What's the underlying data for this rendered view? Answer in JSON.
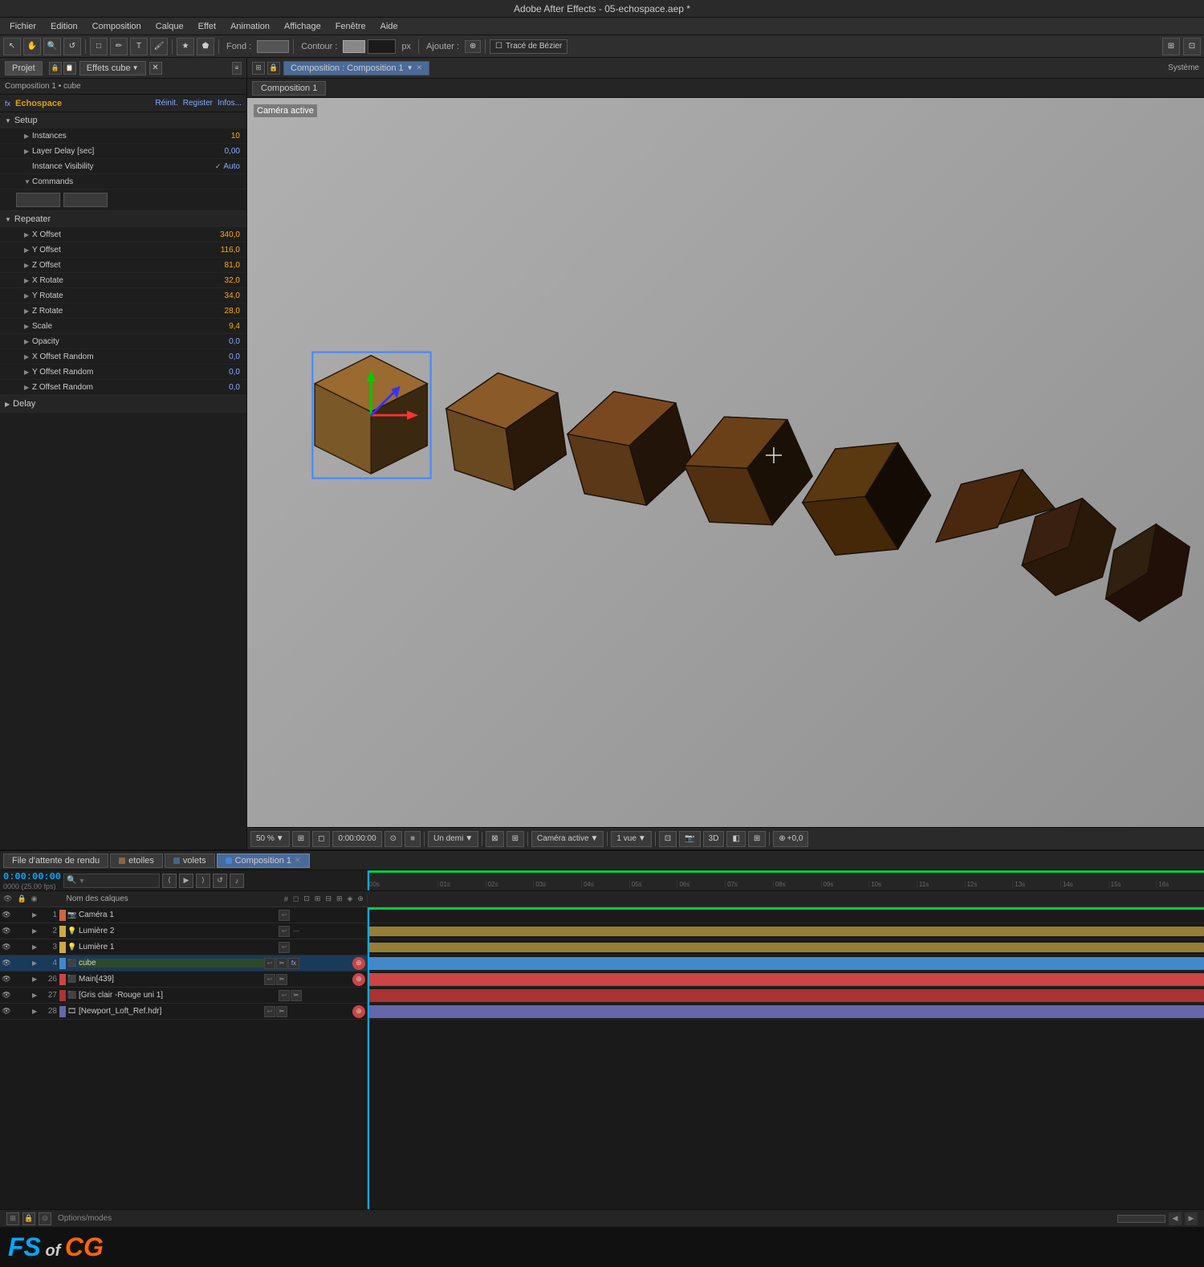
{
  "app": {
    "title": "Adobe After Effects - 05-echospace.aep *",
    "edition_label": "Edition"
  },
  "menubar": {
    "items": [
      "Fichier",
      "Edition",
      "Composition",
      "Calque",
      "Effet",
      "Animation",
      "Affichage",
      "Fenêtre",
      "Aide"
    ]
  },
  "toolbar": {
    "fond_label": "Fond :",
    "contour_label": "Contour :",
    "px_label": "px",
    "ajouter_label": "Ajouter :",
    "trace_label": "Tracé de Bézier"
  },
  "project_panel": {
    "title": "Effets cube",
    "breadcrumb": "Composition 1 • cube",
    "effects_name": "Echospace",
    "reinit": "Réinit.",
    "register": "Register",
    "infos": "Infos..."
  },
  "effects": {
    "setup": {
      "name": "Setup",
      "instances_label": "Instances",
      "instances_value": "10",
      "layer_delay_label": "Layer Delay [sec]",
      "layer_delay_value": "0,00",
      "instance_visibility_label": "Instance Visibility",
      "instance_visibility_value": "Auto",
      "commands_label": "Commands"
    },
    "repeater": {
      "name": "Repeater",
      "x_offset_label": "X Offset",
      "x_offset_value": "340,0",
      "y_offset_label": "Y Offset",
      "y_offset_value": "116,0",
      "z_offset_label": "Z Offset",
      "z_offset_value": "81,0",
      "x_rotate_label": "X Rotate",
      "x_rotate_value": "32,0",
      "y_rotate_label": "Y Rotate",
      "y_rotate_value": "34,0",
      "z_rotate_label": "Z Rotate",
      "z_rotate_value": "28,0",
      "scale_label": "Scale",
      "scale_value": "9,4",
      "opacity_label": "Opacity",
      "opacity_value": "0,0",
      "x_offset_random_label": "X Offset Random",
      "x_offset_random_value": "0,0",
      "y_offset_random_label": "Y Offset Random",
      "y_offset_random_value": "0,0",
      "z_offset_random_label": "Z Offset Random",
      "z_offset_random_value": "0,0"
    },
    "delay": {
      "name": "Delay"
    }
  },
  "viewer": {
    "composition_label": "Composition : Composition 1",
    "tab_label": "Composition 1",
    "camera_label": "Caméra active",
    "zoom": "50 %",
    "quality": "Un demi",
    "camera_dropdown": "Caméra active",
    "view_label": "1 vue",
    "offset_value": "+0,0"
  },
  "timeline": {
    "tabs": [
      {
        "label": "File d'attente de rendu"
      },
      {
        "label": "etoiles"
      },
      {
        "label": "volets"
      },
      {
        "label": "Composition 1",
        "active": true
      }
    ],
    "timecode": "0:00:00:00",
    "fps": "0000 (25.00 fps)",
    "search_placeholder": "🔍",
    "columns": {
      "layer_name": "Nom des calques"
    },
    "layers": [
      {
        "num": 1,
        "name": "Caméra 1",
        "color": "#cc6644",
        "type": "camera"
      },
      {
        "num": 2,
        "name": "Lumière 2",
        "color": "#ccaa44",
        "type": "light"
      },
      {
        "num": 3,
        "name": "Lumière 1",
        "color": "#ccaa44",
        "type": "light"
      },
      {
        "num": 4,
        "name": "cube",
        "color": "#4488cc",
        "type": "solid",
        "selected": true
      },
      {
        "num": 26,
        "name": "Main[439]",
        "color": "#cc4444",
        "type": "solid"
      },
      {
        "num": 27,
        "name": "[Gris clair -Rouge uni 1]",
        "color": "#aa3333",
        "type": "solid"
      },
      {
        "num": 28,
        "name": "[Newport_Loft_Ref.hdr]",
        "color": "#6666aa",
        "type": "footage"
      }
    ],
    "ruler_marks": [
      "00s",
      "01s",
      "02s",
      "03s",
      "04s",
      "05s",
      "06s",
      "07s",
      "08s",
      "09s",
      "10s",
      "11s",
      "12s",
      "13s",
      "14s",
      "15s",
      "16s"
    ]
  },
  "status_bar": {
    "options_modes": "Options/modes"
  },
  "watermark": {
    "text_fs": "FS",
    "text_of": " of ",
    "text_cg": "CG"
  }
}
